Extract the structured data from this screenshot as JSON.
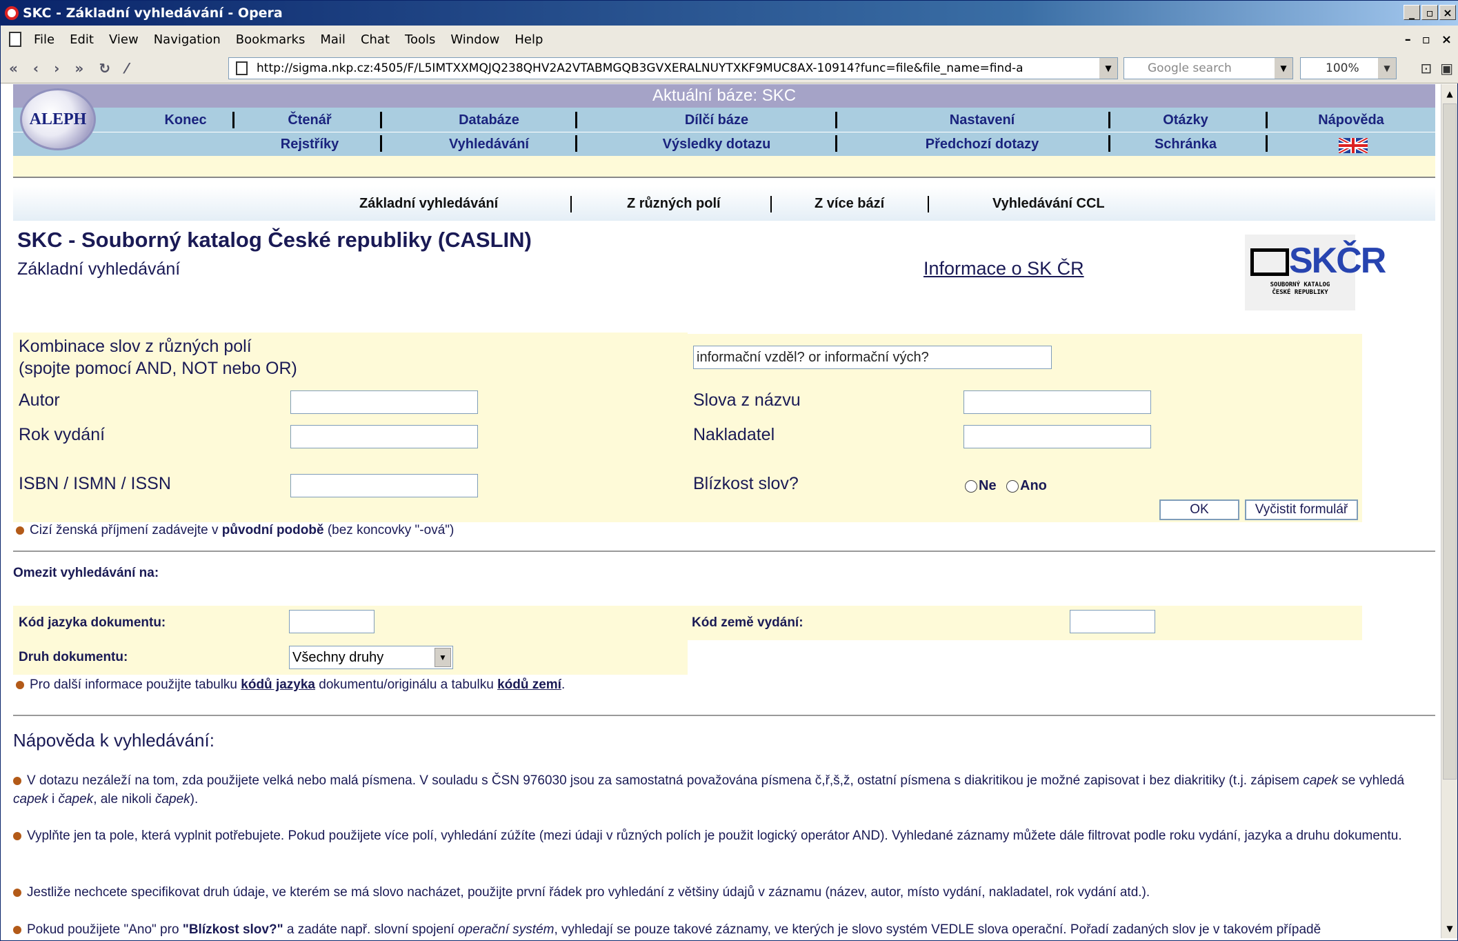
{
  "window": {
    "title": "SKC - Základní vyhledávání - Opera"
  },
  "menu": [
    "File",
    "Edit",
    "View",
    "Navigation",
    "Bookmarks",
    "Mail",
    "Chat",
    "Tools",
    "Window",
    "Help"
  ],
  "toolbar": {
    "address": "http://sigma.nkp.cz:4505/F/L5IMTXXMQJQ238QHV2A2VTABMGQB3GVXERALNUYTXKF9MUC8AX-10914?func=file&file_name=find-a",
    "search_placeholder": "Google search",
    "zoom": "100%"
  },
  "header": {
    "banner": "Aktuální báze: SKC",
    "logo": "ALEPH",
    "row1": [
      "Konec",
      "Čtenář",
      "Databáze",
      "Dílčí báze",
      "Nastavení",
      "Otázky",
      "Nápověda"
    ],
    "row2": [
      "Rejstříky",
      "Vyhledávání",
      "Výsledky dotazu",
      "Předchozí dotazy",
      "Schránka"
    ]
  },
  "subnav": [
    "Základní vyhledávání",
    "Z různých polí",
    "Z více bází",
    "Vyhledávání CCL"
  ],
  "page": {
    "title": "SKC - Souborný katalog České republiky (CASLIN)",
    "subtitle": "Základní vyhledávání",
    "info_link": "Informace o SK ČR",
    "logo_text": "SKČR",
    "logo_sub1": "SOUBORNÝ KATALOG",
    "logo_sub2": "ČESKÉ REPUBLIKY"
  },
  "form": {
    "combo_label1": "Kombinace slov z různých polí",
    "combo_label2": "(spojte pomocí AND, NOT nebo OR)",
    "combo_value": "informační vzděl? or informační vých?",
    "autor": "Autor",
    "rok": "Rok vydání",
    "isbn": "ISBN / ISMN / ISSN",
    "slova": "Slova z názvu",
    "nakladatel": "Nakladatel",
    "blizkost": "Blízkost slov?",
    "radio_no": "Ne",
    "radio_yes": "Ano",
    "ok": "OK",
    "clear": "Vyčistit formulář"
  },
  "note1": {
    "pre": "Cizí ženská příjmení zadávejte v ",
    "bold": "původní podobě",
    "post": " (bez koncovky \"-ová\")"
  },
  "limit": {
    "heading": "Omezit vyhledávání na:",
    "lang": "Kód jazyka dokumentu:",
    "country": "Kód země vydání:",
    "type": "Druh dokumentu:",
    "type_value": "Všechny druhy"
  },
  "note2": {
    "pre": "Pro další informace použijte tabulku ",
    "link1": "kódů jazyka",
    "mid": " dokumentu/originálu a tabulku ",
    "link2": "kódů zemí",
    "post": "."
  },
  "help": {
    "heading": "Nápověda k vyhledávání:",
    "p1a": "V dotazu nezáleží na tom, zda použijete velká nebo malá písmena. V souladu s ČSN 976030 jsou za samostatná považována písmena č,ř,š,ž, ostatní písmena s diakritikou je možné zapisovat i bez diakritiky (t.j. zápisem ",
    "p1b": "capek",
    "p1c": " se vyhledá ",
    "p1d": "capek",
    "p1e": " i ",
    "p1f": "čapek",
    "p1g": ", ale nikoli ",
    "p1h": "čapek",
    "p1i": ").",
    "p2": "Vyplňte jen ta pole, která vyplnit potřebujete. Pokud použijete více polí, vyhledání zúžíte (mezi údaji v různých polích je použit logický operátor AND). Vyhledané záznamy můžete dále filtrovat podle roku vydání, jazyka a druhu dokumentu.",
    "p3": "Jestliže nechcete specifikovat druh údaje, ve kterém se má slovo nacházet, použijte první řádek pro vyhledání z většiny údajů v záznamu (název, autor, místo vydání, nakladatel, rok vydání atd.).",
    "p4a": "Pokud použijete \"Ano\" pro ",
    "p4b": "\"Blízkost slov?\"",
    "p4c": " a zadáte např. slovní spojení ",
    "p4d": "operační systém",
    "p4e": ", vyhledají se pouze takové záznamy, ve kterých je slovo systém VEDLE slova operační. Pořadí zadaných slov je v takovém případě"
  }
}
